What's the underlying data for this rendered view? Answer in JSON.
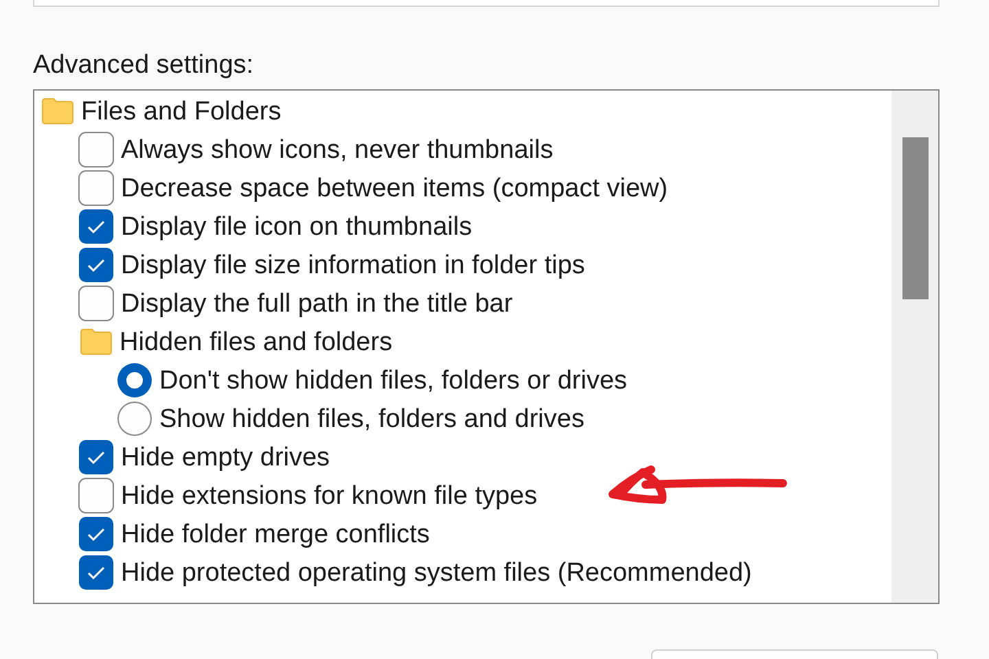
{
  "advanced_settings": {
    "label": "Advanced settings:",
    "tree": [
      {
        "kind": "folder",
        "label": "Files and Folders",
        "children": [
          {
            "kind": "checkbox",
            "label": "Always show icons, never thumbnails",
            "checked": false
          },
          {
            "kind": "checkbox",
            "label": "Decrease space between items (compact view)",
            "checked": false
          },
          {
            "kind": "checkbox",
            "label": "Display file icon on thumbnails",
            "checked": true
          },
          {
            "kind": "checkbox",
            "label": "Display file size information in folder tips",
            "checked": true
          },
          {
            "kind": "checkbox",
            "label": "Display the full path in the title bar",
            "checked": false
          },
          {
            "kind": "folder",
            "label": "Hidden files and folders",
            "children": [
              {
                "kind": "radio",
                "label": "Don't show hidden files, folders or drives",
                "selected": true
              },
              {
                "kind": "radio",
                "label": "Show hidden files, folders and drives",
                "selected": false
              }
            ]
          },
          {
            "kind": "checkbox",
            "label": "Hide empty drives",
            "checked": true
          },
          {
            "kind": "checkbox",
            "label": "Hide extensions for known file types",
            "checked": false
          },
          {
            "kind": "checkbox",
            "label": "Hide folder merge conflicts",
            "checked": true
          },
          {
            "kind": "checkbox",
            "label": "Hide protected operating system files (Recommended)",
            "checked": true
          }
        ]
      }
    ]
  }
}
